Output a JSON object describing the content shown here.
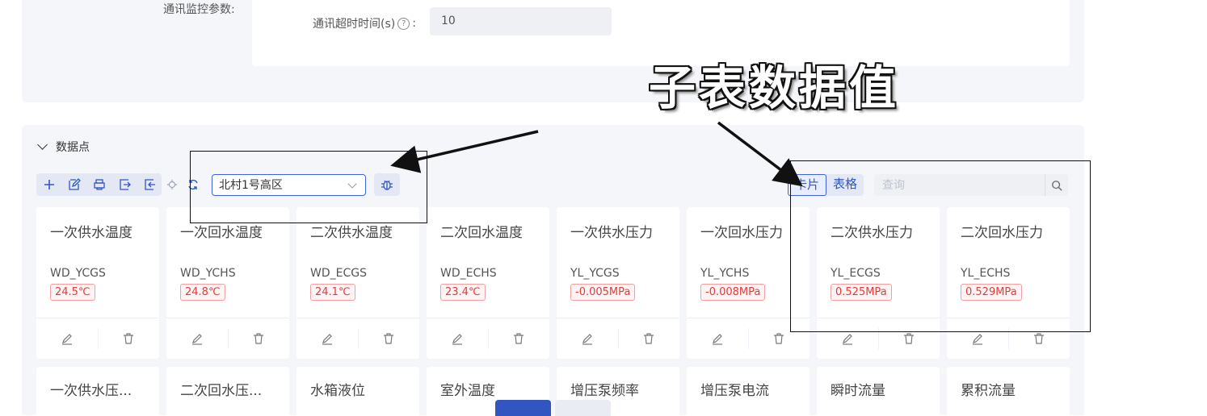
{
  "settings": {
    "monitor_label": "通讯监控参数:",
    "timeout_label": "通讯超时时间(s)",
    "timeout_colon": ":",
    "timeout_value": "10"
  },
  "section": {
    "title": "数据点"
  },
  "toolbar": {
    "area_selected": "北村1号高区",
    "view_card": "卡片",
    "view_table": "表格",
    "search_placeholder": "查询"
  },
  "cards": [
    {
      "title": "一次供水温度",
      "code": "WD_YCGS",
      "value": "24.5℃"
    },
    {
      "title": "一次回水温度",
      "code": "WD_YCHS",
      "value": "24.8℃"
    },
    {
      "title": "二次供水温度",
      "code": "WD_ECGS",
      "value": "24.1℃"
    },
    {
      "title": "二次回水温度",
      "code": "WD_ECHS",
      "value": "23.4℃"
    },
    {
      "title": "一次供水压力",
      "code": "YL_YCGS",
      "value": "-0.005MPa"
    },
    {
      "title": "一次回水压力",
      "code": "YL_YCHS",
      "value": "-0.008MPa"
    },
    {
      "title": "二次供水压力",
      "code": "YL_ECGS",
      "value": "0.525MPa"
    },
    {
      "title": "二次回水压力",
      "code": "YL_ECHS",
      "value": "0.529MPa"
    }
  ],
  "cards_row2": [
    {
      "title": "一次供水压..."
    },
    {
      "title": "二次回水压..."
    },
    {
      "title": "水箱液位"
    },
    {
      "title": "室外温度"
    },
    {
      "title": "增压泵频率"
    },
    {
      "title": "增压泵电流"
    },
    {
      "title": "瞬时流量"
    },
    {
      "title": "累积流量"
    }
  ],
  "annotation": {
    "text": "子表数据值"
  },
  "colors": {
    "primary": "#3156c2",
    "value_red": "#e03c3c",
    "panel_bg": "#f5f6f9"
  }
}
